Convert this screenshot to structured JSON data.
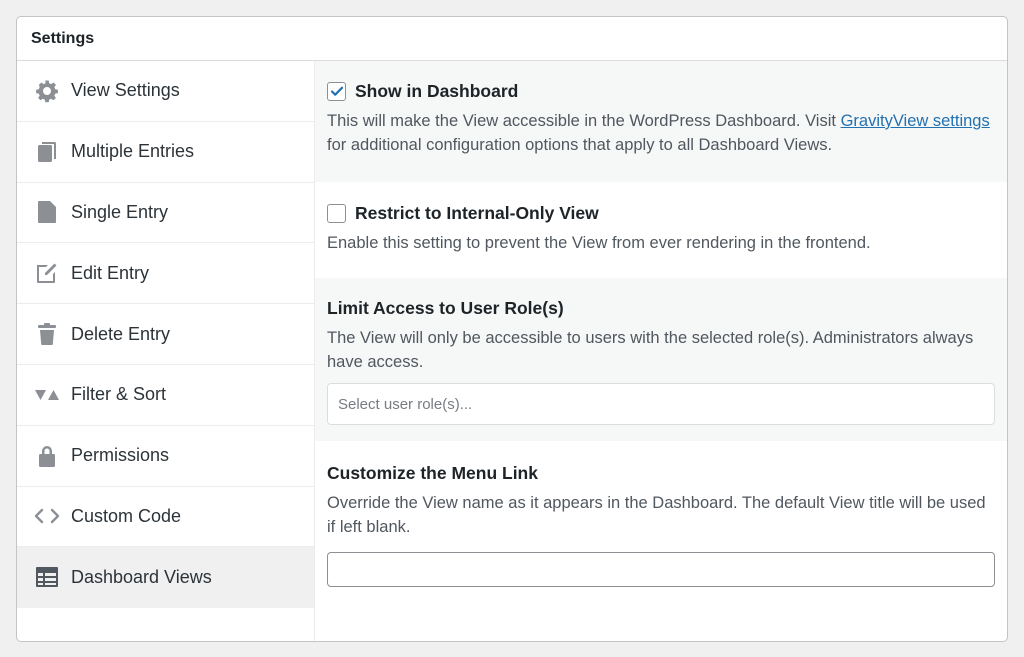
{
  "panel": {
    "title": "Settings"
  },
  "sidebar": {
    "items": [
      {
        "label": "View Settings",
        "icon": "gear-icon"
      },
      {
        "label": "Multiple Entries",
        "icon": "copy-icon"
      },
      {
        "label": "Single Entry",
        "icon": "document-icon"
      },
      {
        "label": "Edit Entry",
        "icon": "edit-icon"
      },
      {
        "label": "Delete Entry",
        "icon": "trash-icon"
      },
      {
        "label": "Filter & Sort",
        "icon": "sort-icon"
      },
      {
        "label": "Permissions",
        "icon": "lock-icon"
      },
      {
        "label": "Custom Code",
        "icon": "code-icon"
      },
      {
        "label": "Dashboard Views",
        "icon": "table-icon",
        "active": true
      }
    ]
  },
  "main": {
    "show_dashboard": {
      "label": "Show in Dashboard",
      "checked": true,
      "desc_before": "This will make the View accessible in the WordPress Dashboard. Visit ",
      "link_text": "GravityView settings",
      "desc_after": " for additional configuration options that apply to all Dashboard Views."
    },
    "restrict": {
      "label": "Restrict to Internal-Only View",
      "checked": false,
      "desc": "Enable this setting to prevent the View from ever rendering in the frontend."
    },
    "limit_access": {
      "title": "Limit Access to User Role(s)",
      "desc": "The View will only be accessible to users with the selected role(s). Administrators always have access.",
      "placeholder": "Select user role(s)..."
    },
    "menu_link": {
      "title": "Customize the Menu Link",
      "desc": "Override the View name as it appears in the Dashboard. The default View title will be used if left blank.",
      "value": ""
    }
  },
  "colors": {
    "accent": "#2271b1",
    "active_bg": "#f0f0f1",
    "section_alt_bg": "#f6f7f7"
  }
}
